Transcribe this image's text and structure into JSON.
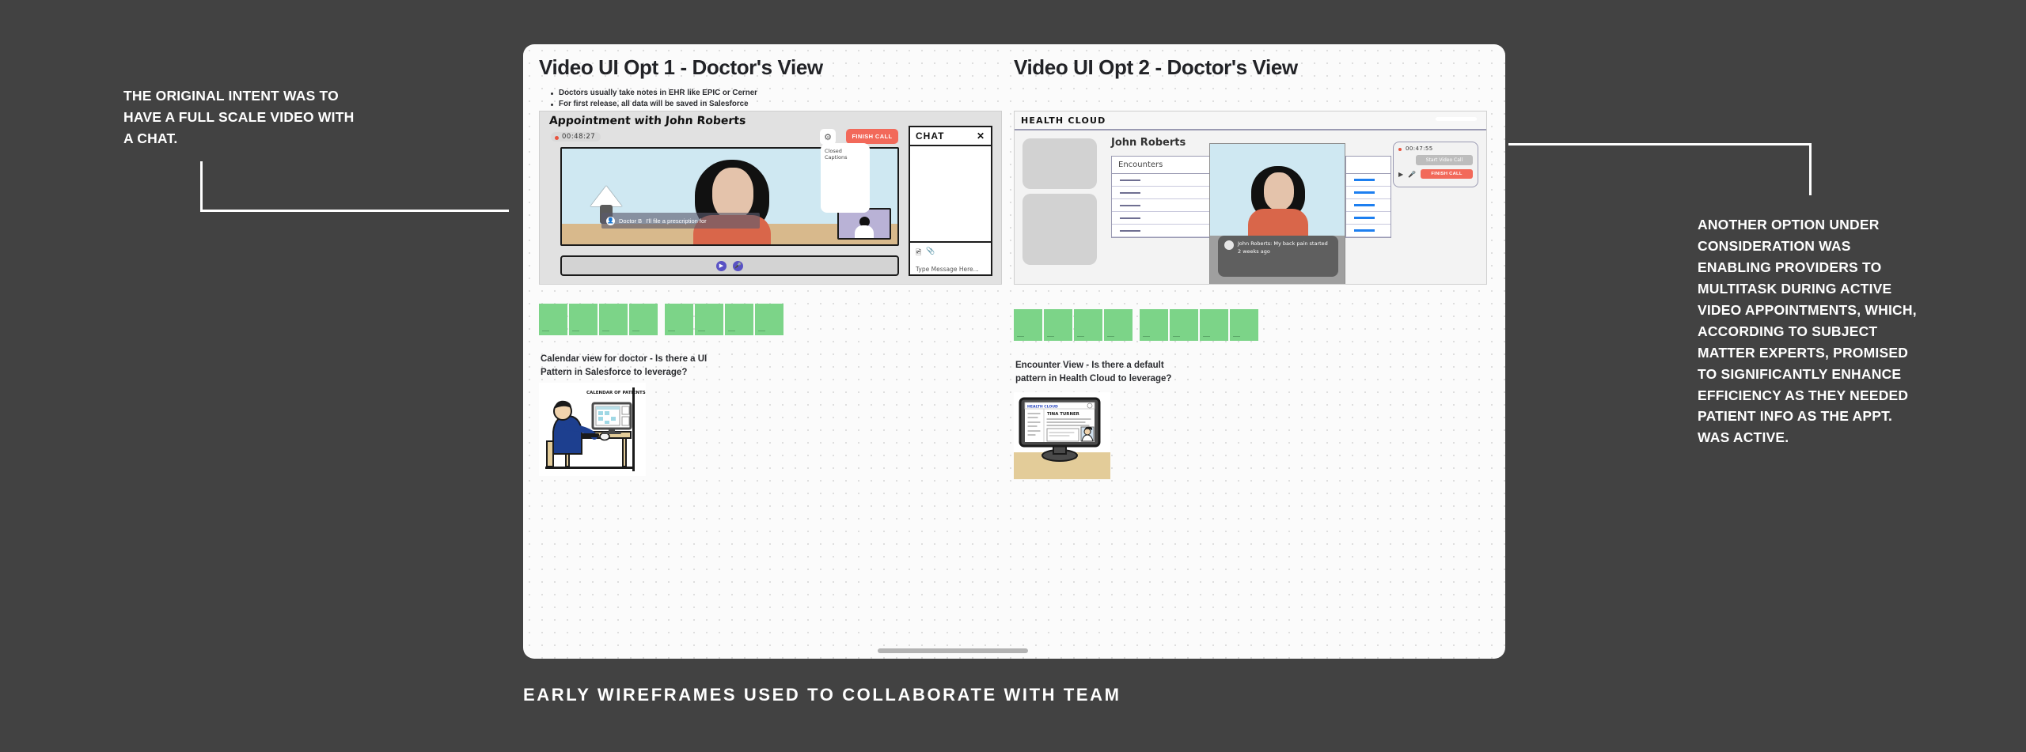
{
  "annotations": {
    "left": "The original intent was to have a full scale video with a chat.",
    "right": "Another option under consideration was enabling providers to multitask during active video appointments, which, according to subject matter experts, promised to significantly enhance efficiency as they needed patient info as the appt. was active."
  },
  "bottom_caption": "Early wireframes used to collaborate with team",
  "board": {
    "option1": {
      "title": "Video UI Opt 1 - Doctor's View",
      "bullets": [
        "Doctors usually take notes in EHR like EPIC or Cerner",
        "For first release, all data will be saved in Salesforce"
      ],
      "mockup": {
        "title": "Appointment with John Roberts",
        "timer": "00:48:27",
        "gear_icon": "gear-icon",
        "finish_call": "Finish Call",
        "closed_captions": "Closed Captions",
        "caption_speaker": "Doctor B",
        "caption_text": "I'll file a prescription for",
        "chat_title": "CHAT",
        "chat_close": "✕",
        "chat_placeholder": "Type Message Here...",
        "chat_image_icon": "image-icon",
        "chat_attach_icon": "paperclip-icon",
        "toolbar_video_icon": "video-icon",
        "toolbar_mic_icon": "microphone-icon"
      },
      "section_caption": "Calendar view for doctor - Is there a UI\nPattern in Salesforce to leverage?",
      "illustration_label": "CALENDAR OF PATIENTS",
      "sticky_count": 8
    },
    "option2": {
      "title": "Video UI Opt 2 - Doctor's View",
      "mockup": {
        "app_name": "HEALTH CLOUD",
        "patient_name": "John Roberts",
        "table_header": "Encounters",
        "timer": "00:47:55",
        "start_video_call": "Start Video Call",
        "finish_call": "Finish Call",
        "caption_speaker": "John Roberts",
        "caption_text": ": My back pain started 2 weeks ago",
        "ctrl_video_icon": "video-icon",
        "ctrl_mic_icon": "microphone-icon"
      },
      "section_caption": "Encounter View - Is there a default\npattern in Health Cloud to leverage?",
      "illustration_app": "HEALTH CLOUD",
      "illustration_patient": "TINA TURNER",
      "sticky_count": 8
    }
  },
  "colors": {
    "page_background": "#424242",
    "board_background": "#fbfbfb",
    "sticky_green": "#7cd488",
    "finish_call_red": "#f2695a",
    "video_sky_blue": "#cfe8f2",
    "shirt_orange": "#d9664a",
    "accent_purple": "#5952c4",
    "link_blue": "#1d7ff0",
    "text_dark": "#2b2c30",
    "text_white": "#ffffff"
  }
}
